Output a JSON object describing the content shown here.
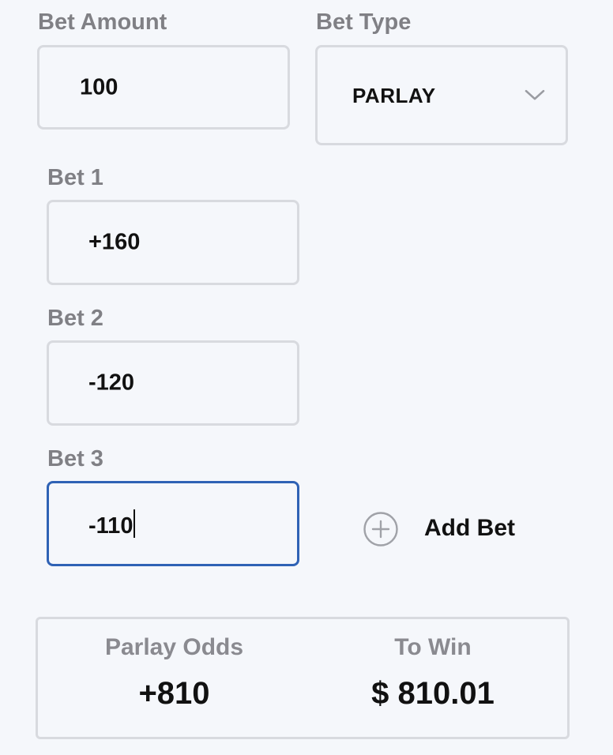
{
  "bet_amount": {
    "label": "Bet Amount",
    "value": "100"
  },
  "bet_type": {
    "label": "Bet Type",
    "selected": "PARLAY",
    "icon": "chevron-down-icon"
  },
  "bets": [
    {
      "label": "Bet 1",
      "value": "+160"
    },
    {
      "label": "Bet 2",
      "value": "-120"
    },
    {
      "label": "Bet 3",
      "value": "-110",
      "focused": true
    }
  ],
  "add_bet": {
    "label": "Add Bet",
    "icon": "plus-circle-icon"
  },
  "results": {
    "odds_label": "Parlay Odds",
    "odds_value": "+810",
    "to_win_label": "To Win",
    "to_win_value": "$ 810.01"
  },
  "colors": {
    "background": "#f5f7fb",
    "border": "#d8dadf",
    "focus_border": "#2f62b5",
    "label_gray": "#808085",
    "text": "#111111"
  }
}
